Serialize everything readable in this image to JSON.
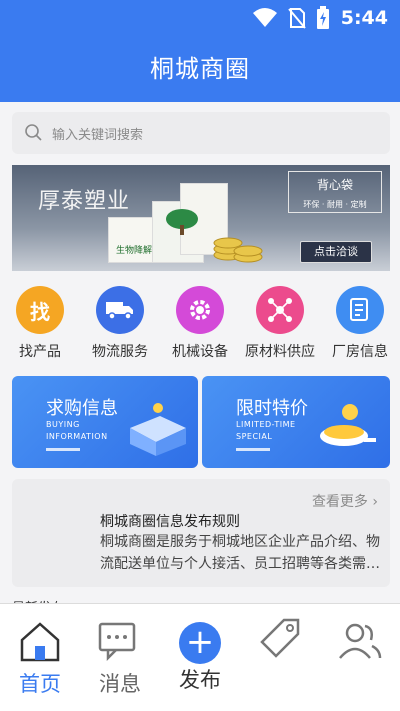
{
  "status": {
    "time": "5:44"
  },
  "header": {
    "title": "桐城商圈"
  },
  "search": {
    "placeholder": "输入关键词搜索"
  },
  "banner": {
    "brand": "厚泰塑业",
    "tag": "背心袋",
    "tag_sub": "环保 · 耐用 · 定制",
    "bag_label": "生物降解袋",
    "button": "点击洽谈"
  },
  "categories": [
    {
      "label": "找产品",
      "glyph": "找",
      "icon": "find-icon",
      "color": "#f5a623"
    },
    {
      "label": "物流服务",
      "icon": "truck-icon",
      "color": "#3c6fe6"
    },
    {
      "label": "机械设备",
      "icon": "gear-icon",
      "color": "#d44ad8"
    },
    {
      "label": "原材料供应",
      "icon": "molecule-icon",
      "color": "#ec4b8d"
    },
    {
      "label": "厂房信息",
      "icon": "document-icon",
      "color": "#3f8df2"
    }
  ],
  "promos": [
    {
      "title": "求购信息",
      "subtitle1": "BUYING",
      "subtitle2": "INFORMATION",
      "color": "#3f86f1"
    },
    {
      "title": "限时特价",
      "subtitle1": "LIMITED-TIME",
      "subtitle2": "SPECIAL",
      "color": "#3a7bf0"
    }
  ],
  "notice": {
    "more": "查看更多 ›",
    "title": "桐城商圈信息发布规则",
    "text": "桐城商圈是服务于桐城地区企业产品介绍、物流配送单位与个人接活、员工招聘等各类需…"
  },
  "partial_section": "最新发布",
  "tabs": [
    {
      "label": "首页",
      "icon": "home-icon",
      "active": true
    },
    {
      "label": "消息",
      "icon": "message-icon",
      "active": false
    },
    {
      "label": "发布",
      "icon": "plus-icon",
      "active": false
    },
    {
      "label": "",
      "icon": "tag-icon",
      "active": false
    },
    {
      "label": "",
      "icon": "user-icon",
      "active": false
    }
  ]
}
